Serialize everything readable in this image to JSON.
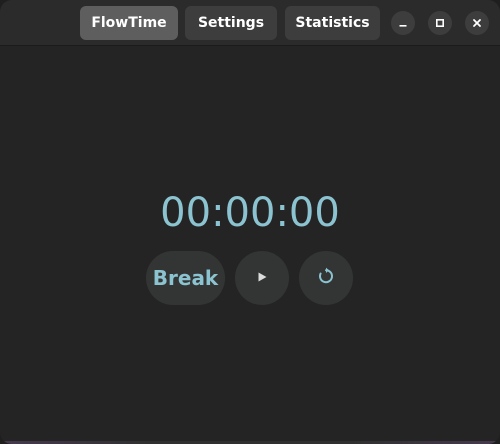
{
  "header": {
    "tabs": [
      {
        "label": "FlowTime",
        "active": true
      },
      {
        "label": "Settings",
        "active": false
      },
      {
        "label": "Statistics",
        "active": false
      }
    ],
    "window_controls": {
      "minimize_icon": "minimize-icon",
      "maximize_icon": "maximize-icon",
      "close_icon": "close-icon"
    }
  },
  "main": {
    "timer": "00:00:00",
    "break_label": "Break",
    "play_icon": "play-icon",
    "reset_icon": "reset-icon"
  },
  "colors": {
    "accent": "#8cc3d0",
    "background": "#242424",
    "headerbar": "#2b2b2b",
    "active_tab": "#5e5e5e",
    "inactive_tab": "#3d3d3d",
    "control_button": "#333535"
  }
}
